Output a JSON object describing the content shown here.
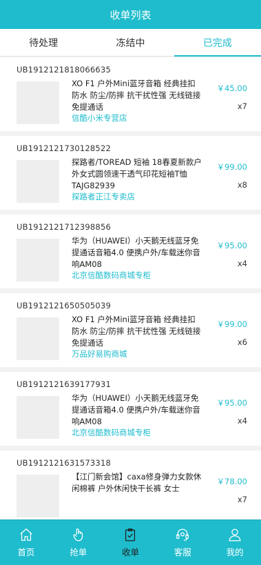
{
  "header": {
    "title": "收单列表"
  },
  "tabs": [
    {
      "label": "待处理",
      "active": false
    },
    {
      "label": "冻结中",
      "active": false
    },
    {
      "label": "已完成",
      "active": true
    }
  ],
  "orders": [
    {
      "order_no": "UB1912121818066635",
      "title": "XO F1 户外Mini蓝牙音箱 经典挂扣 防水 防尘/防摔 抗干扰性强 无线链接 免提通话",
      "shop": "信酷小米专营店",
      "price": "￥45.00",
      "qty": "x7"
    },
    {
      "order_no": "UB1912121730128522",
      "title": "探路者/TOREAD 短袖 18春夏新款户外女式圆领速干透气印花短袖T恤TAJG82939",
      "shop": "探路者正江专卖店",
      "price": "￥99.00",
      "qty": "x8"
    },
    {
      "order_no": "UB1912121712398856",
      "title": "华为（HUAWEI）小天鹅无线蓝牙免提通话音箱4.0 便携户外/车载迷你音响AM08",
      "shop": "北京信酷数码商城专柜",
      "price": "￥95.00",
      "qty": "x4"
    },
    {
      "order_no": "UB1912121650505039",
      "title": "XO F1 户外Mini蓝牙音箱 经典挂扣 防水 防尘/防摔 抗干扰性强 无线链接 免提通话",
      "shop": "万品好易购商城",
      "price": "￥99.00",
      "qty": "x6"
    },
    {
      "order_no": "UB1912121639177931",
      "title": "华为（HUAWEI）小天鹅无线蓝牙免提通话音箱4.0 便携户外/车载迷你音响AM08",
      "shop": "北京信酷数码商城专柜",
      "price": "￥95.00",
      "qty": "x4"
    },
    {
      "order_no": "UB1912121631573318",
      "title": "【江门新会馆】caxa修身弹力女款休闲棉裤 户外休闲快干长裤 女士",
      "shop": "",
      "price": "￥78.00",
      "qty": "x7"
    }
  ],
  "tabbar": [
    {
      "label": "首页",
      "icon": "home-icon",
      "active": false
    },
    {
      "label": "抢单",
      "icon": "hand-icon",
      "active": false
    },
    {
      "label": "收单",
      "icon": "clipboard-icon",
      "active": true
    },
    {
      "label": "客服",
      "icon": "headset-icon",
      "active": false
    },
    {
      "label": "我的",
      "icon": "user-icon",
      "active": false
    }
  ]
}
